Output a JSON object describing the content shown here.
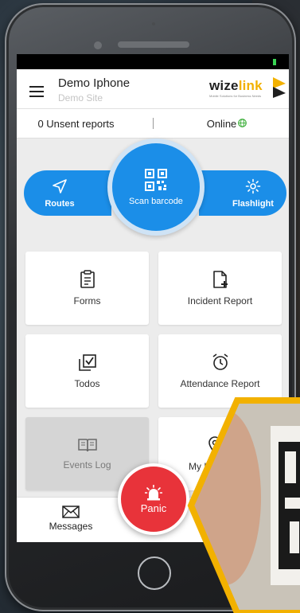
{
  "app": {
    "device_name": "Demo Iphone",
    "site_name": "Demo Site",
    "logo": {
      "text_dark": "wize",
      "text_accent": "link",
      "tagline": "Mobile Solutions for Business Needs"
    }
  },
  "info_bar": {
    "unsent": "0 Unsent reports",
    "status": "Online"
  },
  "actions": {
    "routes": "Routes",
    "scan": "Scan barcode",
    "flashlight": "Flashlight"
  },
  "tiles": [
    {
      "label": "Forms",
      "icon": "clipboard-icon"
    },
    {
      "label": "Incident Report",
      "icon": "file-add-icon"
    },
    {
      "label": "Todos",
      "icon": "checklist-icon"
    },
    {
      "label": "Attendance Report",
      "icon": "alarm-clock-icon"
    },
    {
      "label": "Events Log",
      "icon": "book-icon"
    },
    {
      "label": "My L",
      "icon": "location-pin-icon"
    }
  ],
  "bottom_nav": {
    "messages": "Messages"
  },
  "panic": {
    "label": "Panic"
  },
  "colors": {
    "primary": "#1b8ee8",
    "panic": "#e8333a",
    "accent": "#f2b100",
    "online": "#3cae39"
  }
}
